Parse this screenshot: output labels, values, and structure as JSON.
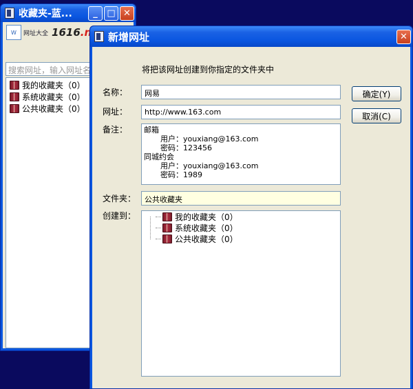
{
  "fav_window": {
    "title": "收藏夹-蓝...",
    "brand_box": "网址大全",
    "brand_text": "网址大全",
    "brand_logo_a": "1616",
    "brand_logo_b": ".net",
    "search_placeholder": "搜索网址，输入网址名",
    "folders": [
      {
        "label": "我的收藏夹（0）",
        "icon": "book-icon"
      },
      {
        "label": "系统收藏夹（0）",
        "icon": "book-icon"
      },
      {
        "label": "公共收藏夹（0）",
        "icon": "book-icon"
      }
    ]
  },
  "dialog": {
    "title": "新增网址",
    "instruction": "将把该网址创建到你指定的文件夹中",
    "name_label": "名称：",
    "name_value": "网易",
    "url_label": "网址：",
    "url_value": "http://www.163.com",
    "notes_label": "备注：",
    "notes_lines": [
      "邮箱",
      "用户：youxiang@163.com",
      "密码：123456",
      "同城约会",
      "用户：youxiang@163.com",
      "密码：1989"
    ],
    "folder_label": "文件夹：",
    "folder_value": "公共收藏夹",
    "create_label": "创建到：",
    "create_tree": [
      {
        "label": "我的收藏夹（0）"
      },
      {
        "label": "系统收藏夹（0）"
      },
      {
        "label": "公共收藏夹（0）"
      }
    ],
    "ok_button": "确定(Y)",
    "cancel_button": "取消(C)"
  },
  "colors": {
    "desktop": "#0a0a5e",
    "titlebar": "#0a56e0",
    "dialog_face": "#ece9d8",
    "folder_field_bg": "#ffffe1"
  }
}
